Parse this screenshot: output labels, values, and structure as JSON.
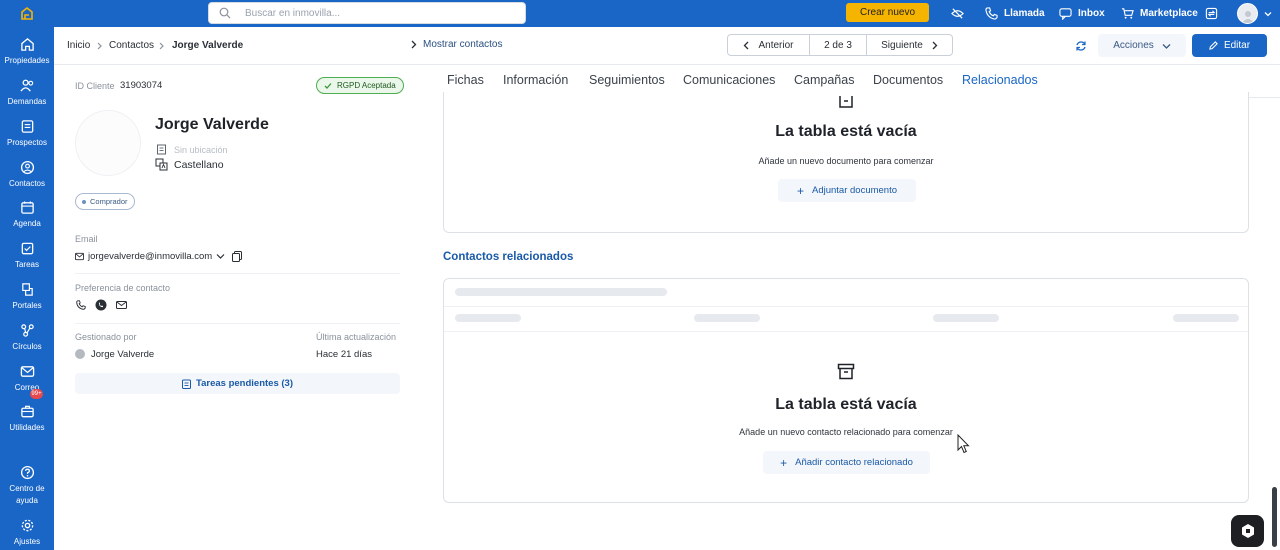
{
  "topbar": {
    "search_placeholder": "Buscar en inmovilla...",
    "create_label": "Crear nuevo",
    "call_label": "Llamada",
    "inbox_label": "Inbox",
    "marketplace_label": "Marketplace"
  },
  "sidebar": {
    "items": [
      {
        "label": "Propiedades",
        "icon": "home-icon"
      },
      {
        "label": "Demandas",
        "icon": "users-icon"
      },
      {
        "label": "Prospectos",
        "icon": "clipboard-icon"
      },
      {
        "label": "Contactos",
        "icon": "user-circle-icon"
      },
      {
        "label": "Agenda",
        "icon": "calendar-icon"
      },
      {
        "label": "Tareas",
        "icon": "task-icon"
      },
      {
        "label": "Portales",
        "icon": "portal-icon"
      },
      {
        "label": "Círculos",
        "icon": "graph-icon"
      },
      {
        "label": "Correo",
        "icon": "mail-icon"
      },
      {
        "label": "Utilidades",
        "icon": "briefcase-icon"
      }
    ],
    "mail_badge": "99+",
    "help_label": "Centro de ayuda",
    "settings_label": "Ajustes"
  },
  "breadcrumb": {
    "items": [
      "Inicio",
      "Contactos",
      "Jorge Valverde"
    ]
  },
  "subheader": {
    "show_contacts": "Mostrar contactos",
    "prev_label": "Anterior",
    "page_count": "2 de 3",
    "next_label": "Siguiente",
    "actions_label": "Acciones",
    "edit_label": "Editar"
  },
  "contact": {
    "client_id_label": "ID Cliente",
    "client_id": "31903074",
    "rgpd": "RGPD Aceptada",
    "name": "Jorge Valverde",
    "location": "Sin ubicación",
    "language": "Castellano",
    "tag": "Comprador",
    "email_label": "Email",
    "email": "jorgevalverde@inmovilla.com",
    "preference_label": "Preferencia de contacto",
    "managed_by_label": "Gestionado por",
    "managed_by": "Jorge Valverde",
    "last_update_label": "Última actualización",
    "last_update": "Hace 21 días",
    "pending_tasks": "Tareas pendientes (3)"
  },
  "tabs": [
    "Fichas",
    "Información",
    "Seguimientos",
    "Comunicaciones",
    "Campañas",
    "Documentos",
    "Relacionados"
  ],
  "active_tab": "Relacionados",
  "documents_card": {
    "title": "La tabla está vacía",
    "subtitle": "Añade un nuevo documento para comenzar",
    "button": "Adjuntar documento"
  },
  "related_section": {
    "heading": "Contactos relacionados",
    "title": "La tabla está vacía",
    "subtitle": "Añade un nuevo contacto relacionado para comenzar",
    "button": "Añadir contacto relacionado"
  },
  "colors": {
    "primary": "#1a66c7",
    "accent": "#f5b400",
    "badge": "#e5484d",
    "rgpd_green": "#3a9b3a"
  }
}
